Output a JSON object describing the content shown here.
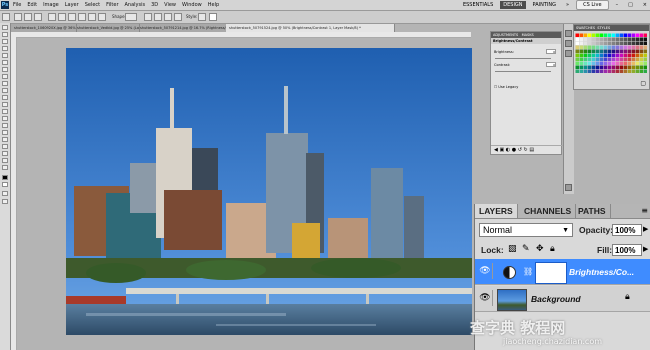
{
  "menu": {
    "logo": "Ps",
    "items": [
      "File",
      "Edit",
      "Image",
      "Layer",
      "Select",
      "Filter",
      "Analysis",
      "3D",
      "View",
      "Window",
      "Help"
    ]
  },
  "workspace": {
    "items": [
      "ESSENTIALS",
      "DESIGN",
      "PAINTING"
    ],
    "active": "DESIGN",
    "cslive": "CS Live"
  },
  "options_bar": {
    "shape_label": "Shape:",
    "style_label": "Style:"
  },
  "doc_tabs": [
    "shutterstock_1060920X.jpg @ 36% (Layer 0, RGB/8#)",
    "shutterstock_Vedkid.jpg @ 25% (Layer 1, RGB/8#)",
    "shutterstock_50791214.jpg @ 16.7% (Rightness/Contrast 1, Layer Mask/8)",
    "shutterstock_50791524.jpg @ 50% (Brightness/Contrast 1, Layer Mask/8) *"
  ],
  "adjustments": {
    "tabs": [
      "ADJUSTMENTS",
      "MASKS"
    ],
    "title": "Brightness/Contrast",
    "brightness_label": "Brightness:",
    "brightness_value": "0",
    "contrast_label": "Contrast:",
    "contrast_value": "0",
    "legacy_label": "Use Legacy"
  },
  "swatches": {
    "tabs": [
      "SWATCHES",
      "STYLES"
    ]
  },
  "layers_panel": {
    "tabs": [
      "LAYERS",
      "CHANNELS",
      "PATHS"
    ],
    "blend_mode": "Normal",
    "opacity_label": "Opacity:",
    "opacity_value": "100%",
    "lock_label": "Lock:",
    "fill_label": "Fill:",
    "fill_value": "100%",
    "layers": [
      {
        "name": "Brightness/Co...",
        "selected": true
      },
      {
        "name": "Background",
        "selected": false
      }
    ]
  },
  "watermark": {
    "main": "查字典 教程网",
    "sub": "jiaocheng.chazidian.com"
  },
  "colors": {
    "selection": "#3f8cff",
    "sky_top": "#1f5fb0",
    "sky_bottom": "#6fa8e6",
    "panel_bg": "#d9d9d9"
  }
}
